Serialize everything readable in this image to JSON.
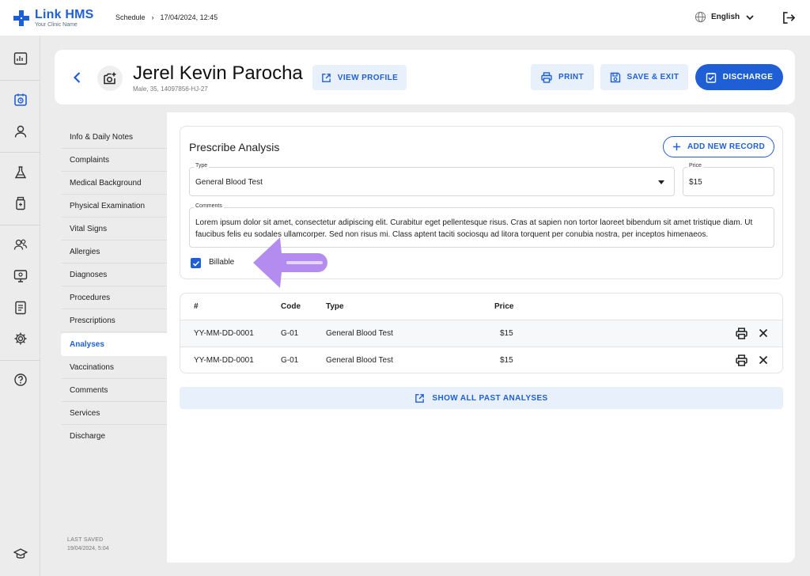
{
  "app": {
    "name": "Link HMS",
    "subtitle": "Your Clinic Name",
    "brand_color": "#1f5fd6"
  },
  "breadcrumb": {
    "items": [
      "Schedule",
      "17/04/2024, 12:45"
    ],
    "separator": "›"
  },
  "language": {
    "selected": "English",
    "icon": "globe-icon"
  },
  "rail": {
    "icons": [
      "dashboard-icon",
      "calendar-icon",
      "user-icon",
      "flask-icon",
      "medicine-bottle-icon",
      "users-icon",
      "monitor-icon",
      "report-icon",
      "gear-icon",
      "help-icon",
      "graduation-cap-icon"
    ],
    "active": "calendar-icon"
  },
  "patient": {
    "name": "Jerel Kevin Parocha",
    "meta": "Male, 35, 14097856-HJ-27"
  },
  "header_actions": {
    "view_profile": "VIEW PROFILE",
    "print": "PRINT",
    "save_exit": "SAVE & EXIT",
    "discharge": "DISCHARGE"
  },
  "nav": {
    "items": [
      "Info & Daily Notes",
      "Complaints",
      "Medical Background",
      "Physical Examination",
      "Vital Signs",
      "Allergies",
      "Diagnoses",
      "Procedures",
      "Prescriptions",
      "Analyses",
      "Vaccinations",
      "Comments",
      "Services",
      "Discharge"
    ],
    "active": "Analyses"
  },
  "last_saved": {
    "label": "LAST SAVED",
    "value": "19/04/2024, 5:04"
  },
  "prescribe": {
    "title": "Prescribe Analysis",
    "add_button": "ADD NEW RECORD",
    "type_label": "Type",
    "type_value": "General Blood Test",
    "price_label": "Price",
    "price_value": "$15",
    "comments_label": "Comments",
    "comments_value": "Lorem ipsum dolor sit amet, consectetur adipiscing elit. Curabitur eget pellentesque risus. Cras at sapien non tortor laoreet bibendum sit amet tristique diam. Ut faucibus felis eu sodales ullamcorper. Sed non risus mi. Class aptent taciti sociosqu ad litora torquent per conubia nostra, per inceptos himenaeos.",
    "billable_label": "Billable",
    "billable_checked": true,
    "annotation_color": "#b48cf0"
  },
  "table": {
    "headers": {
      "num": "#",
      "code": "Code",
      "type": "Type",
      "price": "Price"
    },
    "rows": [
      {
        "num": "YY-MM-DD-0001",
        "code": "G-01",
        "type": "General Blood Test",
        "price": "$15"
      },
      {
        "num": "YY-MM-DD-0001",
        "code": "G-01",
        "type": "General Blood Test",
        "price": "$15"
      }
    ]
  },
  "show_all": "SHOW ALL PAST ANALYSES"
}
